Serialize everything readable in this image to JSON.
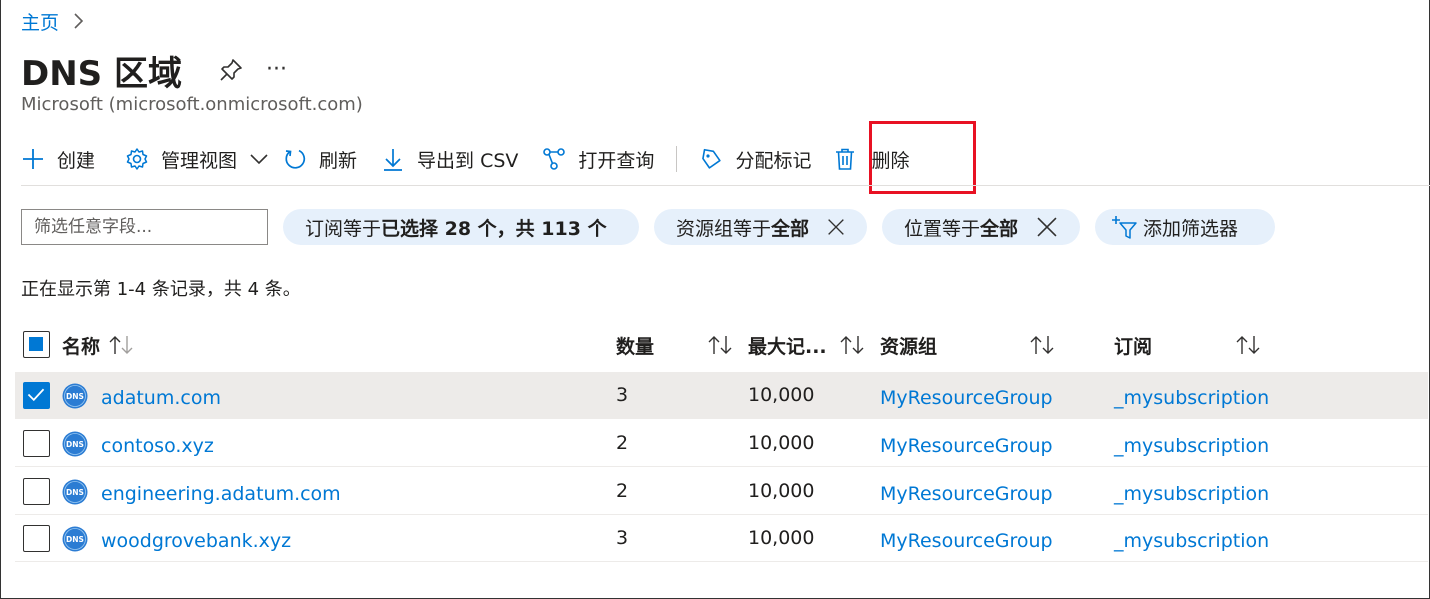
{
  "breadcrumb": {
    "home": "主页"
  },
  "header": {
    "title": "DNS 区域",
    "more": "···",
    "subtitle": "Microsoft (microsoft.onmicrosoft.com)"
  },
  "toolbar": {
    "create": "创建",
    "manage_view": "管理视图",
    "refresh": "刷新",
    "export_csv": "导出到 CSV",
    "open_query": "打开查询",
    "assign_tags": "分配标记",
    "delete": "删除"
  },
  "filters": {
    "search_placeholder": "筛选任意字段...",
    "subscription": {
      "prefix": "订阅等于",
      "value": "已选择 28 个，共 113 个"
    },
    "resource_group": {
      "prefix": "资源组等于",
      "value": "全部"
    },
    "location": {
      "prefix": "位置等于",
      "value": "全部"
    },
    "add_filter": "添加筛选器"
  },
  "record_count": "正在显示第 1-4 条记录，共 4 条。",
  "table": {
    "columns": {
      "name": "名称",
      "count": "数量",
      "max": "最大记...",
      "resource_group": "资源组",
      "subscription": "订阅"
    },
    "rows": [
      {
        "name": "adatum.com",
        "count": "3",
        "max": "10,000",
        "resource_group": "MyResourceGroup",
        "subscription": "_mysubscription",
        "selected": true
      },
      {
        "name": "contoso.xyz",
        "count": "2",
        "max": "10,000",
        "resource_group": "MyResourceGroup",
        "subscription": "_mysubscription",
        "selected": false
      },
      {
        "name": "engineering.adatum.com",
        "count": "2",
        "max": "10,000",
        "resource_group": "MyResourceGroup",
        "subscription": "_mysubscription",
        "selected": false
      },
      {
        "name": "woodgrovebank.xyz",
        "count": "3",
        "max": "10,000",
        "resource_group": "MyResourceGroup",
        "subscription": "_mysubscription",
        "selected": false
      }
    ]
  },
  "dns_icon_text": "DNS",
  "colors": {
    "accent": "#0078d4",
    "highlight": "#e81123",
    "pill_bg": "#e6f0fb",
    "selected_row": "#edebe9"
  }
}
